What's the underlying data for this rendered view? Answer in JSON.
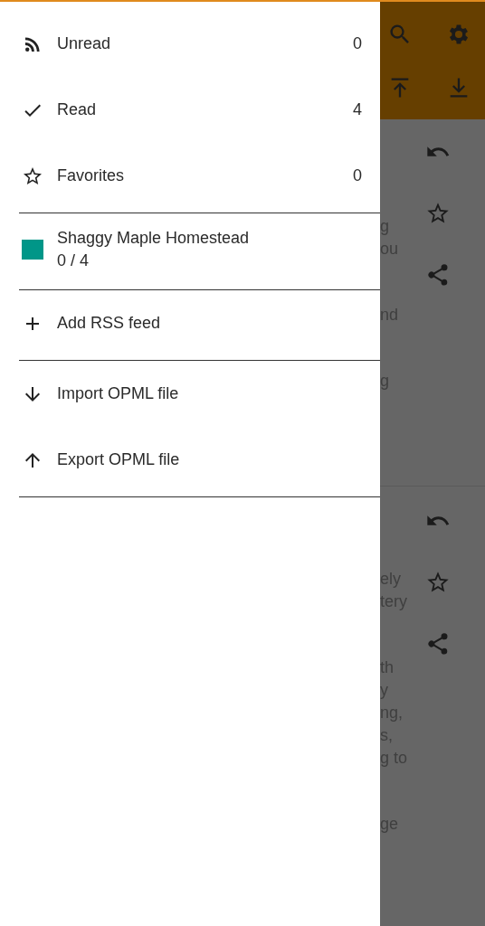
{
  "drawer": {
    "filters": [
      {
        "label": "Unread",
        "count": "0",
        "selected": false
      },
      {
        "label": "Read",
        "count": "4",
        "selected": false
      },
      {
        "label": "Favorites",
        "count": "0",
        "selected": false
      }
    ],
    "feeds": [
      {
        "name": "Shaggy Maple Homestead",
        "count": "0 / 4",
        "color": "#009688",
        "selected": false
      }
    ],
    "actions": [
      {
        "label": "Add RSS feed"
      }
    ],
    "file_actions": [
      {
        "label": "Import OPML file"
      },
      {
        "label": "Export OPML file"
      }
    ]
  },
  "background": {
    "cards": [
      {
        "paragraphs": [
          [
            "g",
            "ou"
          ],
          [
            "nd"
          ],
          [
            "g"
          ]
        ]
      },
      {
        "paragraphs": [
          [
            "ely",
            "tery"
          ],
          [
            "th",
            "y",
            "ng,",
            "s,",
            "g to"
          ],
          [
            "ge"
          ]
        ]
      }
    ]
  }
}
